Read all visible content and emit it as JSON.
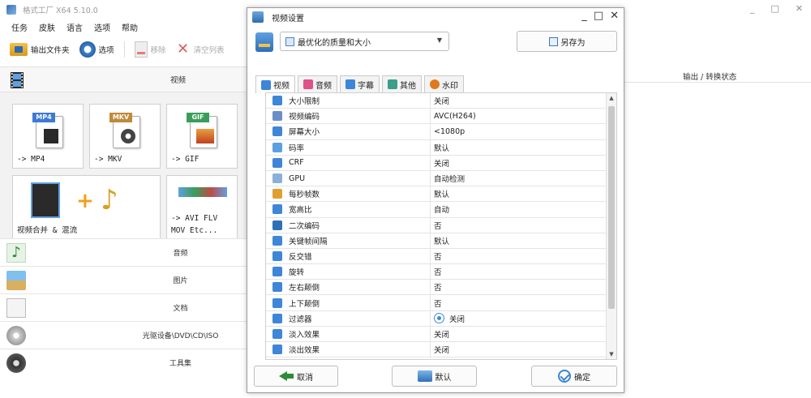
{
  "app": {
    "title": "格式工厂 X64 5.10.0",
    "window_controls": [
      "_",
      "□",
      "✕"
    ]
  },
  "menu": [
    "任务",
    "皮肤",
    "语言",
    "选项",
    "帮助"
  ],
  "toolbar": {
    "output_folder": "输出文件夹",
    "options": "选项",
    "remove": "移除",
    "clear_list": "清空列表"
  },
  "left_panel": {
    "video_category": "视频",
    "formats": [
      {
        "tag": "MP4",
        "label": "-> MP4",
        "tag_color": "#3d7ad6"
      },
      {
        "tag": "MKV",
        "label": "-> MKV",
        "tag_color": "#c08a3a"
      },
      {
        "tag": "GIF",
        "label": "-> GIF",
        "tag_color": "#3a9e5a"
      }
    ],
    "merge_label": "视频合并 & 混流",
    "other_formats_label_line1": "-> AVI FLV",
    "other_formats_label_line2": "MOV Etc...",
    "categories": [
      {
        "name": "音频",
        "icon": "music-note-icon"
      },
      {
        "name": "图片",
        "icon": "picture-icon"
      },
      {
        "name": "文档",
        "icon": "document-icon"
      },
      {
        "name": "光驱设备\\DVD\\CD\\ISO",
        "icon": "disc-icon"
      },
      {
        "name": "工具集",
        "icon": "film-reel-icon"
      }
    ]
  },
  "right_panel": {
    "column_header": "输出 / 转换状态"
  },
  "dialog": {
    "title": "视频设置",
    "controls": [
      "_",
      "□",
      "✕"
    ],
    "preset": "最优化的质量和大小",
    "save_as": "另存为",
    "tabs": [
      {
        "label": "视频",
        "active": true,
        "color": "#3d86d8"
      },
      {
        "label": "音频",
        "active": false,
        "color": "#e0508a"
      },
      {
        "label": "字幕",
        "active": false,
        "color": "#3d86d8"
      },
      {
        "label": "其他",
        "active": false,
        "color": "#3a9e8a"
      },
      {
        "label": "水印",
        "active": false,
        "color": "#e07a20"
      }
    ],
    "settings": [
      {
        "name": "大小限制",
        "value": "关闭",
        "icon_color": "#3d86d8"
      },
      {
        "name": "视频编码",
        "value": "AVC(H264)",
        "icon_color": "#6a8ec8"
      },
      {
        "name": "屏幕大小",
        "value": "<1080p",
        "icon_color": "#3d86d8"
      },
      {
        "name": "码率",
        "value": "默认",
        "icon_color": "#5aa0e0"
      },
      {
        "name": "CRF",
        "value": "关闭",
        "icon_color": "#3d86d8"
      },
      {
        "name": "GPU",
        "value": "自动检测",
        "icon_color": "#8ab0d8"
      },
      {
        "name": "每秒帧数",
        "value": "默认",
        "icon_color": "#e0a030"
      },
      {
        "name": "宽高比",
        "value": "自动",
        "icon_color": "#3d86d8"
      },
      {
        "name": "二次编码",
        "value": "否",
        "icon_color": "#2f6fb6"
      },
      {
        "name": "关键帧间隔",
        "value": "默认",
        "icon_color": "#3d86d8"
      },
      {
        "name": "反交错",
        "value": "否",
        "icon_color": "#3d86d8"
      },
      {
        "name": "旋转",
        "value": "否",
        "icon_color": "#3d86d8"
      },
      {
        "name": "左右颠倒",
        "value": "否",
        "icon_color": "#3d86d8"
      },
      {
        "name": "上下颠倒",
        "value": "否",
        "icon_color": "#3d86d8"
      },
      {
        "name": "过滤器",
        "value": "关闭",
        "icon_color": "#3d86d8",
        "has_chip": true
      },
      {
        "name": "淡入效果",
        "value": "关闭",
        "icon_color": "#3d86d8"
      },
      {
        "name": "淡出效果",
        "value": "关闭",
        "icon_color": "#3d86d8"
      }
    ],
    "buttons": {
      "cancel": "取消",
      "default": "默认",
      "ok": "确定"
    }
  }
}
